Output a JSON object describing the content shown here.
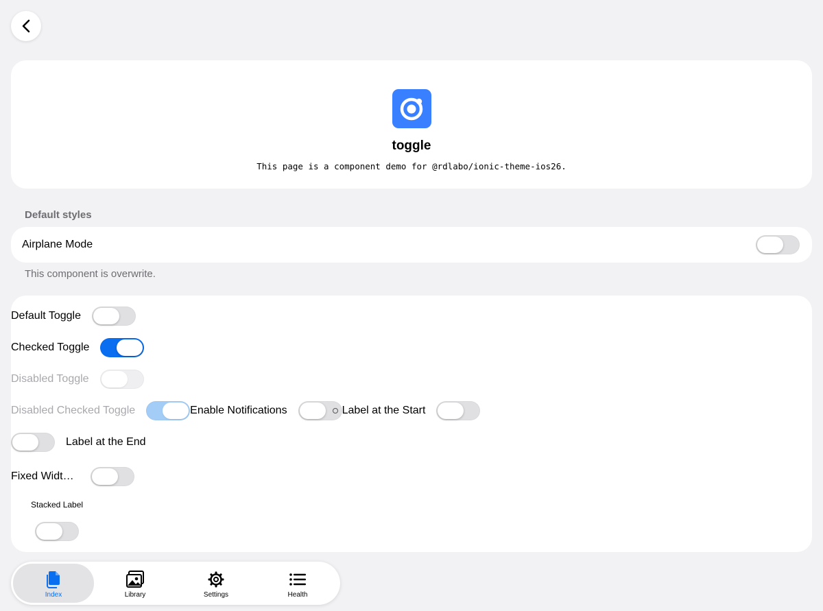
{
  "hero": {
    "title": "toggle",
    "subtitle": "This page is a component demo for @rdlabo/ionic-theme-ios26."
  },
  "section_label": "Default styles",
  "airplane": {
    "label": "Airplane Mode",
    "checked": false
  },
  "note": "This component is overwrite.",
  "toggles": {
    "default": {
      "label": "Default Toggle",
      "checked": false
    },
    "checked": {
      "label": "Checked Toggle",
      "checked": true
    },
    "disabled": {
      "label": "Disabled Toggle",
      "checked": false,
      "disabled": true
    },
    "disabled_checked": {
      "label": "Disabled Checked Toggle",
      "checked": true,
      "disabled": true
    },
    "notifications": {
      "label": "Enable Notifications",
      "checked": false
    },
    "label_start": {
      "label": "Label at the Start",
      "checked": false
    },
    "label_end": {
      "label": "Label at the End",
      "checked": false
    },
    "fixed_width": {
      "label": "Fixed Widt…",
      "checked": false
    },
    "stacked": {
      "label": "Stacked Label",
      "checked": false
    }
  },
  "tabs": [
    {
      "label": "Index",
      "icon": "document-icon",
      "active": true
    },
    {
      "label": "Library",
      "icon": "images-icon",
      "active": false
    },
    {
      "label": "Settings",
      "icon": "gear-icon",
      "active": false
    },
    {
      "label": "Health",
      "icon": "list-icon",
      "active": false
    }
  ],
  "colors": {
    "accent": "#0a6ef0",
    "logo": "#3880ff",
    "background": "#f2f2f4"
  }
}
